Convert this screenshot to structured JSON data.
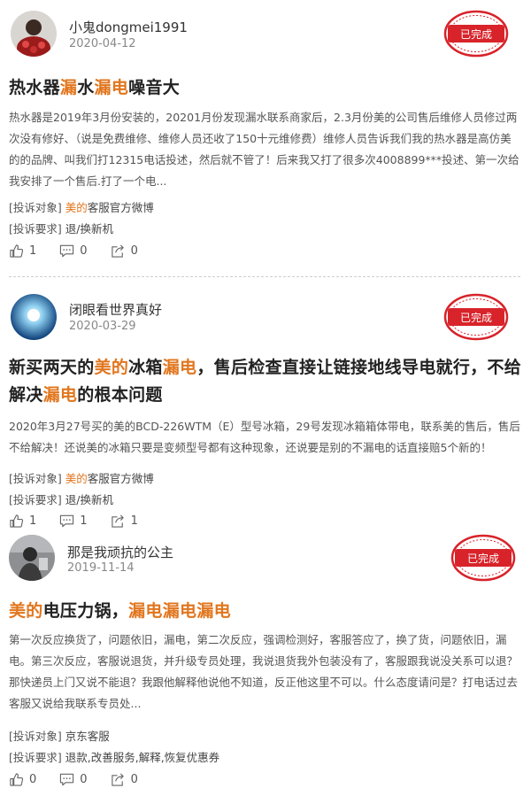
{
  "posts": [
    {
      "username": "小鬼dongmei1991",
      "date": "2020-04-12",
      "status": "已完成",
      "title_segments": [
        {
          "text": "热水器",
          "hl": false
        },
        {
          "text": "漏",
          "hl": true
        },
        {
          "text": "水",
          "hl": false
        },
        {
          "text": "漏电",
          "hl": true
        },
        {
          "text": "噪音大",
          "hl": false
        }
      ],
      "body": "热水器是2019年3月份安装的，20201月份发现漏水联系商家后，2.3月份美的公司售后维修人员修过两次没有修好、（说是免费维修、维修人员还收了150十元维修费）维修人员告诉我们我的热水器是高仿美的的品牌、叫我们打12315电话投述，然后就不管了！后来我又打了很多次4008899***投述、第一次给我安排了一个售后.打了一个电...",
      "target_label": "[投诉对象]",
      "target_segments": [
        {
          "text": "美的",
          "hl": true
        },
        {
          "text": "客服官方微博",
          "hl": false
        }
      ],
      "demand_label": "[投诉要求]",
      "demand": "退/换新机",
      "likes": "1",
      "comments": "0",
      "shares": "0"
    },
    {
      "username": "闭眼看世界真好",
      "date": "2020-03-29",
      "status": "已完成",
      "title_segments": [
        {
          "text": "新买两天的",
          "hl": false
        },
        {
          "text": "美的",
          "hl": true
        },
        {
          "text": "冰箱",
          "hl": false
        },
        {
          "text": "漏电",
          "hl": true
        },
        {
          "text": "，售后检查直接让链接地线导电就行，不给解决",
          "hl": false
        },
        {
          "text": "漏电",
          "hl": true
        },
        {
          "text": "的根本问题",
          "hl": false
        }
      ],
      "body": "2020年3月27号买的美的BCD-226WTM（E）型号冰箱，29号发现冰箱箱体带电，联系美的售后，售后不给解决！还说美的冰箱只要是变频型号都有这种现象，还说要是别的不漏电的话直接赔5个新的！",
      "target_label": "[投诉对象]",
      "target_segments": [
        {
          "text": "美的",
          "hl": true
        },
        {
          "text": "客服官方微博",
          "hl": false
        }
      ],
      "demand_label": "[投诉要求]",
      "demand": "退/换新机",
      "likes": "1",
      "comments": "1",
      "shares": "1"
    },
    {
      "username": "那是我顽抗的公主",
      "date": "2019-11-14",
      "status": "已完成",
      "title_segments": [
        {
          "text": "美的",
          "hl": true
        },
        {
          "text": "电压力锅，",
          "hl": false
        },
        {
          "text": "漏电漏电漏电",
          "hl": true
        }
      ],
      "body": "第一次反应换货了，问题依旧，漏电，第二次反应，强调检测好，客服答应了，换了货，问题依旧，漏电。第三次反应，客服说退货，并升级专员处理，我说退货我外包装没有了，客服跟我说没关系可以退？那快递员上门又说不能退？我跟他解释他说他不知道，反正他这里不可以。什么态度请问是？打电话过去客服又说给我联系专员处...",
      "target_label": "[投诉对象]",
      "target_segments": [
        {
          "text": "京东客服",
          "hl": false
        }
      ],
      "demand_label": "[投诉要求]",
      "demand": "退款,改善服务,解释,恢复优惠券",
      "likes": "0",
      "comments": "0",
      "shares": "0"
    }
  ],
  "colors": {
    "highlight": "#e1761e",
    "stamp_red": "#d8232a",
    "text": "#333333",
    "muted": "#888888"
  },
  "icons": [
    "thumb-up-icon",
    "comment-icon",
    "share-icon",
    "completed-stamp-icon"
  ]
}
